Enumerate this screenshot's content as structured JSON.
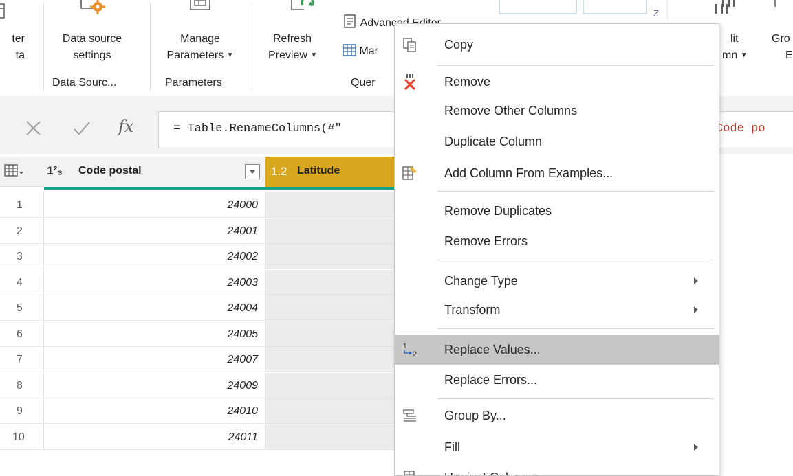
{
  "ribbon": {
    "filter_data": {
      "line1": "ter",
      "line2": "ta"
    },
    "data_source_settings": {
      "line1": "Data source",
      "line2": "settings"
    },
    "manage_parameters": {
      "line1": "Manage",
      "line2": "Parameters"
    },
    "refresh_preview": {
      "line1": "Refresh",
      "line2": "Preview"
    },
    "advanced_editor": "Advanced Editor",
    "manage": "Mar",
    "split_column": {
      "line1": "lit",
      "line2": "mn"
    },
    "group_by": {
      "line1": "Gro",
      "line2": "E"
    },
    "groups": {
      "data_sources": "Data Sourc...",
      "parameters": "Parameters",
      "query": "Quer"
    }
  },
  "formula": {
    "cancel_icon": "x-icon",
    "confirm_icon": "check-icon",
    "fx_label": "fx",
    "text": "= Table.RenameColumns(#\"",
    "tail": "Code po"
  },
  "grid": {
    "columns": [
      {
        "type_label": "1²₃",
        "name": "Code postal"
      },
      {
        "type_label": "1.2",
        "name": "Latitude"
      }
    ],
    "rows": [
      {
        "n": "1",
        "code": "24000"
      },
      {
        "n": "2",
        "code": "24001"
      },
      {
        "n": "3",
        "code": "24002"
      },
      {
        "n": "4",
        "code": "24003"
      },
      {
        "n": "5",
        "code": "24004"
      },
      {
        "n": "6",
        "code": "24005"
      },
      {
        "n": "7",
        "code": "24007"
      },
      {
        "n": "8",
        "code": "24009"
      },
      {
        "n": "9",
        "code": "24010"
      },
      {
        "n": "10",
        "code": "24011"
      }
    ]
  },
  "context_menu": {
    "items": [
      {
        "label": "Copy",
        "icon": "copy-icon"
      },
      {
        "label": "Remove",
        "icon": "remove-column-icon"
      },
      {
        "label": "Remove Other Columns"
      },
      {
        "label": "Duplicate Column"
      },
      {
        "label": "Add Column From Examples...",
        "icon": "column-from-examples-icon"
      },
      {
        "label": "Remove Duplicates"
      },
      {
        "label": "Remove Errors"
      },
      {
        "label": "Change Type",
        "submenu": true
      },
      {
        "label": "Transform",
        "submenu": true
      },
      {
        "label": "Replace Values...",
        "icon": "replace-values-icon",
        "highlighted": true
      },
      {
        "label": "Replace Errors..."
      },
      {
        "label": "Group By...",
        "icon": "group-by-icon"
      },
      {
        "label": "Fill",
        "submenu": true
      },
      {
        "label": "Unpivot Columns",
        "icon": "unpivot-icon"
      }
    ]
  },
  "colors": {
    "accent_header": "#d9a81e",
    "teal_underline": "#11a68d",
    "highlight": "#c8c6c4",
    "remove_red": "#e8412c"
  }
}
